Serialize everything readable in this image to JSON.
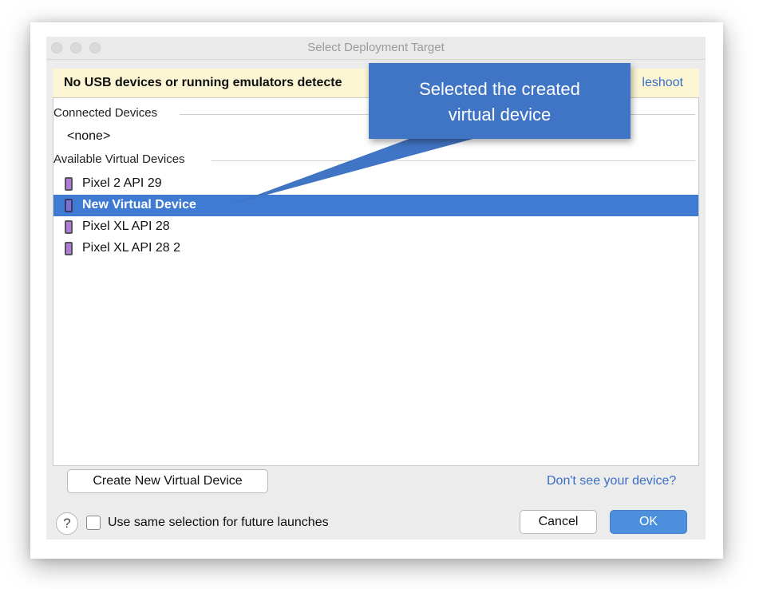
{
  "window": {
    "title": "Select Deployment Target"
  },
  "banner": {
    "message": "No USB devices or running emulators detecte",
    "link_partial": "leshoot"
  },
  "device_list": {
    "connected_header": "Connected Devices",
    "connected_none": "<none>",
    "available_header": "Available Virtual Devices",
    "devices": [
      {
        "label": "Pixel 2 API 29",
        "icon": "phone-icon",
        "selected": false
      },
      {
        "label": "New Virtual Device",
        "icon": "phone-icon",
        "selected": true
      },
      {
        "label": "Pixel XL API 28",
        "icon": "phone-icon",
        "selected": false
      },
      {
        "label": "Pixel XL API 28 2",
        "icon": "phone-icon",
        "selected": false
      }
    ]
  },
  "footer": {
    "create_button": "Create New Virtual Device",
    "help_link": "Don't see your device?",
    "help_glyph": "?",
    "checkbox_label": "Use same selection for future launches",
    "checkbox_checked": false,
    "cancel_button": "Cancel",
    "ok_button": "OK"
  },
  "annotation": {
    "line1": "Selected the created",
    "line2": "virtual device"
  },
  "colors": {
    "selection": "#3f7ad3",
    "banner": "#fbf5d4",
    "link": "#3a6ec7",
    "callout": "#4074c4",
    "primary_button": "#4b8fdd"
  }
}
